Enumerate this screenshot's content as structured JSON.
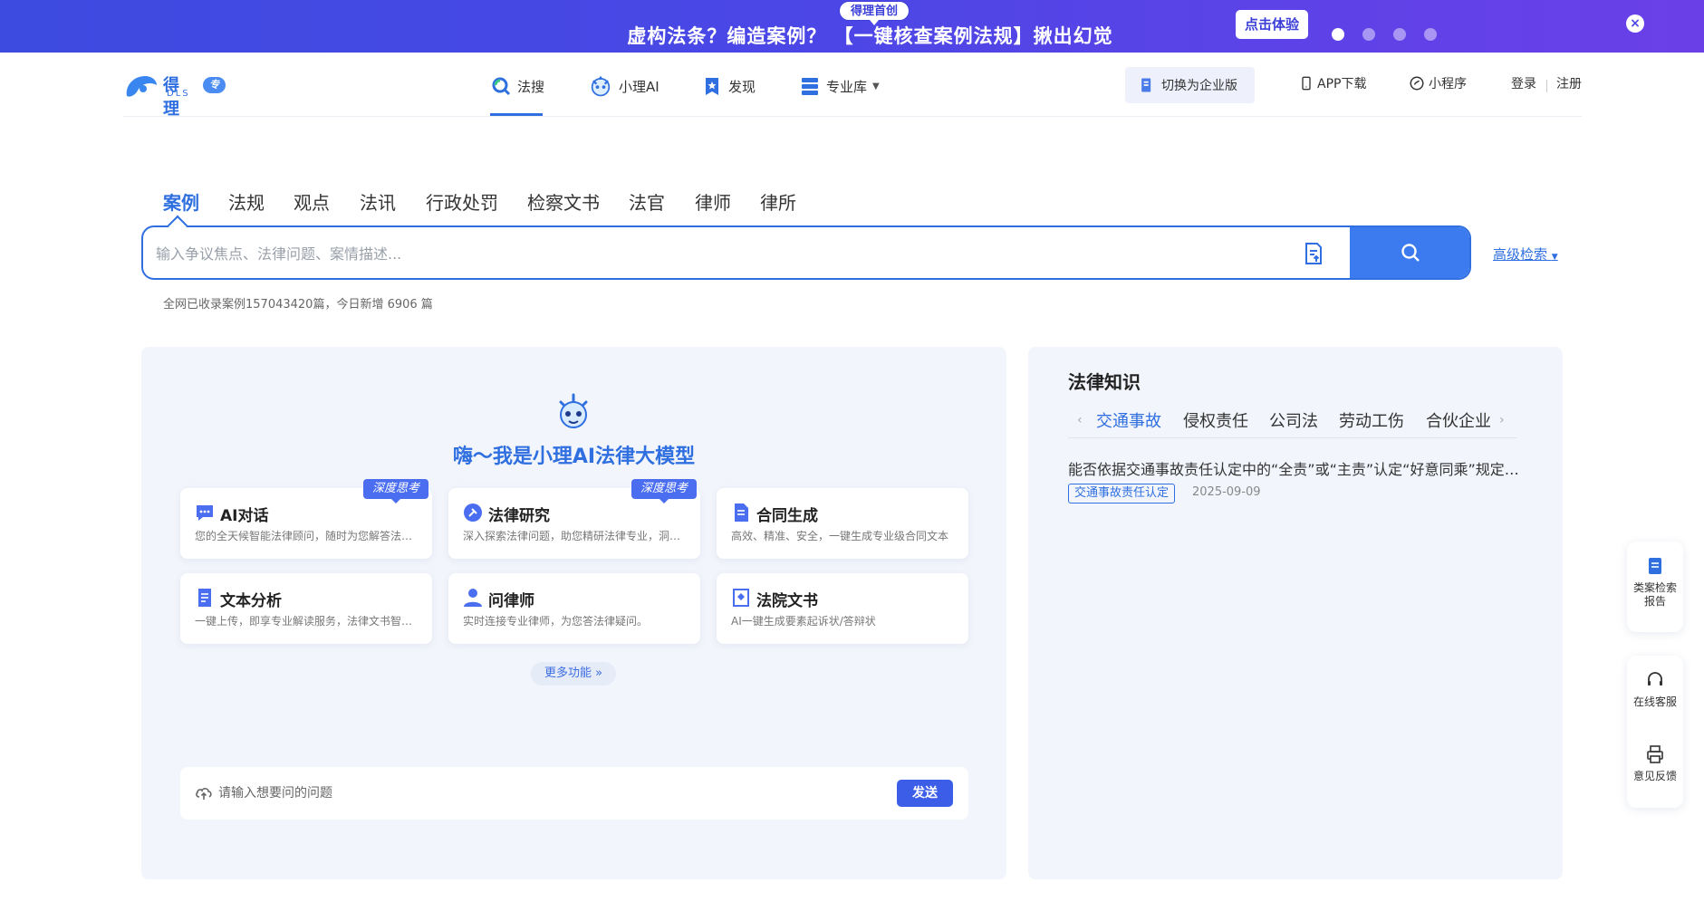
{
  "banner": {
    "tag": "得理首创",
    "text": "虚构法条？编造案例？  【一键核查案例法规】揪出幻觉",
    "cta": "点击体验",
    "close": "×"
  },
  "logo": {
    "name": "得理",
    "sub": "DLS",
    "badge": "专业版"
  },
  "nav": {
    "items": [
      {
        "label": "法搜"
      },
      {
        "label": "小理AI"
      },
      {
        "label": "发现"
      },
      {
        "label": "专业库"
      }
    ],
    "switch": "切换为企业版",
    "app": "APP下载",
    "mini": "小程序",
    "login": "登录",
    "register": "注册"
  },
  "search": {
    "tabs": [
      "案例",
      "法规",
      "观点",
      "法讯",
      "行政处罚",
      "检察文书",
      "法官",
      "律师",
      "律所"
    ],
    "placeholder": "输入争议焦点、法律问题、案情描述...",
    "advanced": "高级检索",
    "stats": "全网已收录案例157043420篇，今日新增 6906 篇"
  },
  "ai": {
    "title": "嗨～我是小理AI法律大模型",
    "cards": [
      {
        "title": "AI对话",
        "desc": "您的全天候智能法律顾问，随时为您解答法律问题",
        "badge": "深度思考"
      },
      {
        "title": "法律研究",
        "desc": "深入探索法律问题，助您精研法律专业，洞察法律",
        "badge": "深度思考"
      },
      {
        "title": "合同生成",
        "desc": "高效、精准、安全，一键生成专业级合同文本",
        "badge": ""
      },
      {
        "title": "文本分析",
        "desc": "一键上传，即享专业解读服务，法律文书智能分析",
        "badge": ""
      },
      {
        "title": "问律师",
        "desc": "实时连接专业律师，为您答法律疑问。",
        "badge": ""
      },
      {
        "title": "法院文书",
        "desc": "AI一键生成要素起诉状/答辩状",
        "badge": ""
      }
    ],
    "more": "更多功能 »",
    "ask_placeholder": "请输入想要问的问题",
    "send": "发送"
  },
  "knowledge": {
    "title": "法律知识",
    "tabs": [
      "交通事故",
      "侵权责任",
      "公司法",
      "劳动工伤",
      "合伙企业"
    ],
    "article": "能否依据交通事故责任认定中的“全责”或“主责”认定“好意同乘”规定中的重大过失",
    "tag": "交通事故责任认定",
    "date": "2025-09-09"
  },
  "floating": {
    "similar": "类案检索报告",
    "service": "在线客服",
    "feedback": "意见反馈"
  },
  "colors": {
    "primary": "#2f6fe0",
    "banner": "#4a47e6",
    "panel": "#f2f5fb"
  }
}
